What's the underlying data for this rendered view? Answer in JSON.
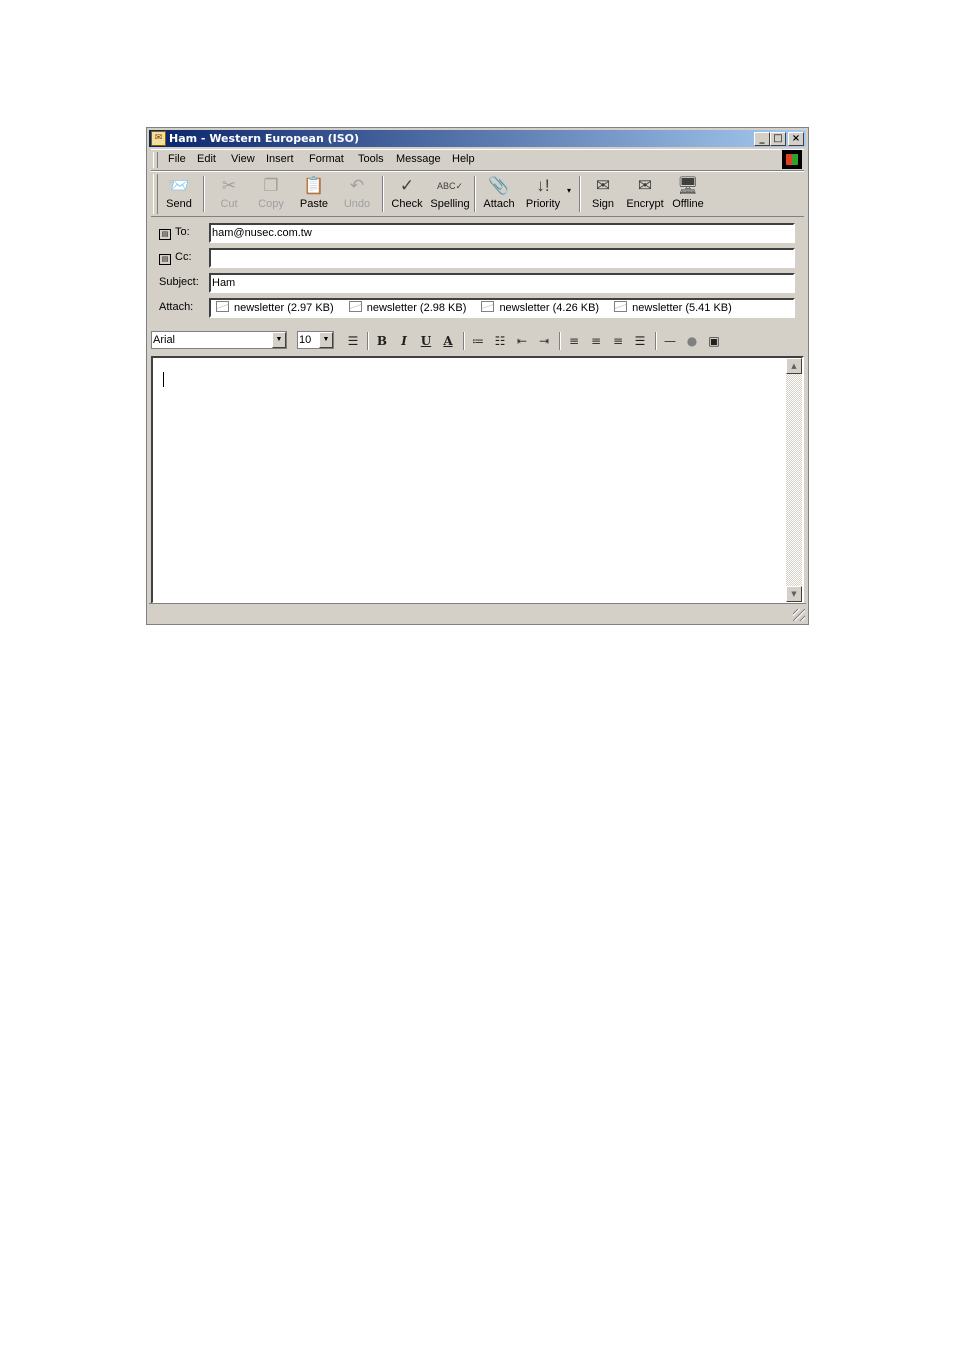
{
  "window": {
    "title": "Ham - Western European (ISO)",
    "controls": [
      "minimize",
      "maximize",
      "close"
    ]
  },
  "menu": {
    "items": [
      "File",
      "Edit",
      "View",
      "Insert",
      "Format",
      "Tools",
      "Message",
      "Help"
    ]
  },
  "toolbar": {
    "buttons": [
      {
        "label": "Send",
        "icon": "send-icon",
        "enabled": true
      },
      {
        "label": "Cut",
        "icon": "scissors-icon",
        "enabled": false
      },
      {
        "label": "Copy",
        "icon": "copy-icon",
        "enabled": false
      },
      {
        "label": "Paste",
        "icon": "paste-icon",
        "enabled": true
      },
      {
        "label": "Undo",
        "icon": "undo-icon",
        "enabled": false
      },
      {
        "label": "Check",
        "icon": "check-names-icon",
        "enabled": true
      },
      {
        "label": "Spelling",
        "icon": "spelling-icon",
        "enabled": true
      },
      {
        "label": "Attach",
        "icon": "paperclip-icon",
        "enabled": true
      },
      {
        "label": "Priority",
        "icon": "priority-icon",
        "enabled": true
      },
      {
        "label": "Sign",
        "icon": "sign-icon",
        "enabled": true
      },
      {
        "label": "Encrypt",
        "icon": "encrypt-icon",
        "enabled": true
      },
      {
        "label": "Offline",
        "icon": "offline-icon",
        "enabled": true
      }
    ]
  },
  "header": {
    "to_label": "To:",
    "to_value": "ham@nusec.com.tw",
    "cc_label": "Cc:",
    "cc_value": "",
    "subject_label": "Subject:",
    "subject_value": "Ham",
    "attach_label": "Attach:",
    "attachments": [
      "newsletter (2.97 KB)",
      "newsletter (2.98 KB)",
      "newsletter (4.26 KB)",
      "newsletter (5.41 KB)"
    ]
  },
  "format": {
    "font": "Arial",
    "size": "10",
    "bold": "B",
    "italic": "I",
    "underline": "U",
    "font_color": "A"
  },
  "body": {
    "text": ""
  },
  "colors": {
    "title_start": "#0a246a",
    "title_end": "#a6caf0",
    "chrome": "#d4d0c8"
  }
}
